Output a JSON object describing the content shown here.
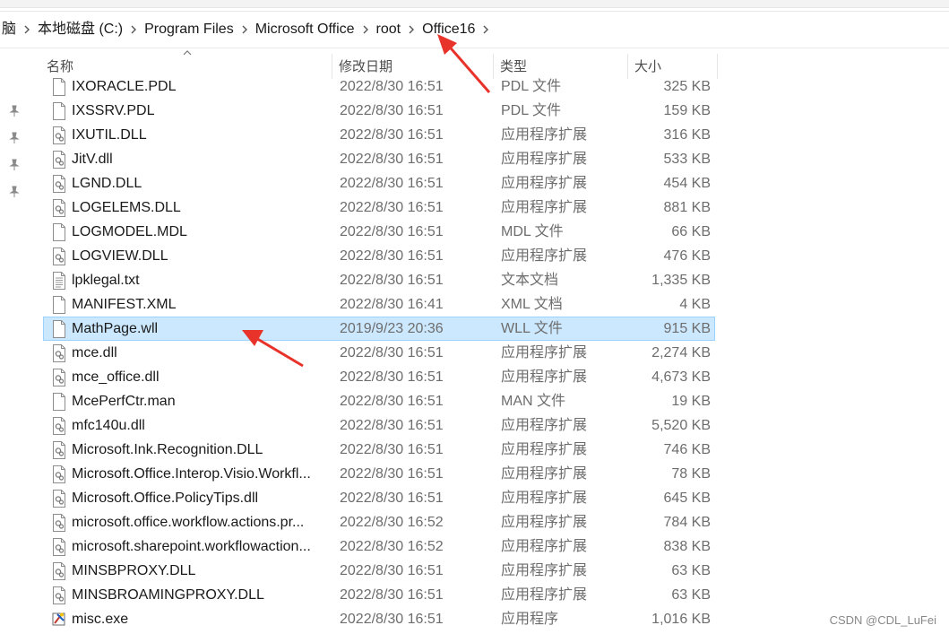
{
  "breadcrumb": {
    "items": [
      "脑",
      "本地磁盘 (C:)",
      "Program Files",
      "Microsoft Office",
      "root",
      "Office16"
    ]
  },
  "columns": {
    "name": "名称",
    "date": "修改日期",
    "type": "类型",
    "size": "大小"
  },
  "files": [
    {
      "name": "IXORACLE.PDL",
      "date": "2022/8/30 16:51",
      "type": "PDL 文件",
      "size": "325 KB",
      "icon": "generic-file-icon"
    },
    {
      "name": "IXSSRV.PDL",
      "date": "2022/8/30 16:51",
      "type": "PDL 文件",
      "size": "159 KB",
      "icon": "generic-file-icon"
    },
    {
      "name": "IXUTIL.DLL",
      "date": "2022/8/30 16:51",
      "type": "应用程序扩展",
      "size": "316 KB",
      "icon": "dll-file-icon"
    },
    {
      "name": "JitV.dll",
      "date": "2022/8/30 16:51",
      "type": "应用程序扩展",
      "size": "533 KB",
      "icon": "dll-file-icon"
    },
    {
      "name": "LGND.DLL",
      "date": "2022/8/30 16:51",
      "type": "应用程序扩展",
      "size": "454 KB",
      "icon": "dll-file-icon"
    },
    {
      "name": "LOGELEMS.DLL",
      "date": "2022/8/30 16:51",
      "type": "应用程序扩展",
      "size": "881 KB",
      "icon": "dll-file-icon"
    },
    {
      "name": "LOGMODEL.MDL",
      "date": "2022/8/30 16:51",
      "type": "MDL 文件",
      "size": "66 KB",
      "icon": "generic-file-icon"
    },
    {
      "name": "LOGVIEW.DLL",
      "date": "2022/8/30 16:51",
      "type": "应用程序扩展",
      "size": "476 KB",
      "icon": "dll-file-icon"
    },
    {
      "name": "lpklegal.txt",
      "date": "2022/8/30 16:51",
      "type": "文本文档",
      "size": "1,335 KB",
      "icon": "text-file-icon"
    },
    {
      "name": "MANIFEST.XML",
      "date": "2022/8/30 16:41",
      "type": "XML 文档",
      "size": "4 KB",
      "icon": "generic-file-icon"
    },
    {
      "name": "MathPage.wll",
      "date": "2019/9/23 20:36",
      "type": "WLL 文件",
      "size": "915 KB",
      "icon": "generic-file-icon",
      "selected": true
    },
    {
      "name": "mce.dll",
      "date": "2022/8/30 16:51",
      "type": "应用程序扩展",
      "size": "2,274 KB",
      "icon": "dll-file-icon"
    },
    {
      "name": "mce_office.dll",
      "date": "2022/8/30 16:51",
      "type": "应用程序扩展",
      "size": "4,673 KB",
      "icon": "dll-file-icon"
    },
    {
      "name": "McePerfCtr.man",
      "date": "2022/8/30 16:51",
      "type": "MAN 文件",
      "size": "19 KB",
      "icon": "generic-file-icon"
    },
    {
      "name": "mfc140u.dll",
      "date": "2022/8/30 16:51",
      "type": "应用程序扩展",
      "size": "5,520 KB",
      "icon": "dll-file-icon"
    },
    {
      "name": "Microsoft.Ink.Recognition.DLL",
      "date": "2022/8/30 16:51",
      "type": "应用程序扩展",
      "size": "746 KB",
      "icon": "dll-file-icon"
    },
    {
      "name": "Microsoft.Office.Interop.Visio.Workfl...",
      "date": "2022/8/30 16:51",
      "type": "应用程序扩展",
      "size": "78 KB",
      "icon": "dll-file-icon"
    },
    {
      "name": "Microsoft.Office.PolicyTips.dll",
      "date": "2022/8/30 16:51",
      "type": "应用程序扩展",
      "size": "645 KB",
      "icon": "dll-file-icon"
    },
    {
      "name": "microsoft.office.workflow.actions.pr...",
      "date": "2022/8/30 16:52",
      "type": "应用程序扩展",
      "size": "784 KB",
      "icon": "dll-file-icon"
    },
    {
      "name": "microsoft.sharepoint.workflowaction...",
      "date": "2022/8/30 16:52",
      "type": "应用程序扩展",
      "size": "838 KB",
      "icon": "dll-file-icon"
    },
    {
      "name": "MINSBPROXY.DLL",
      "date": "2022/8/30 16:51",
      "type": "应用程序扩展",
      "size": "63 KB",
      "icon": "dll-file-icon"
    },
    {
      "name": "MINSBROAMINGPROXY.DLL",
      "date": "2022/8/30 16:51",
      "type": "应用程序扩展",
      "size": "63 KB",
      "icon": "dll-file-icon"
    },
    {
      "name": "misc.exe",
      "date": "2022/8/30 16:51",
      "type": "应用程序",
      "size": "1,016 KB",
      "icon": "exe-file-icon"
    }
  ],
  "watermark": "CSDN @CDL_LuFei",
  "colors": {
    "selection_bg": "#cce8ff",
    "selection_border": "#99d1ff",
    "annotation_arrow": "#e8332b"
  }
}
